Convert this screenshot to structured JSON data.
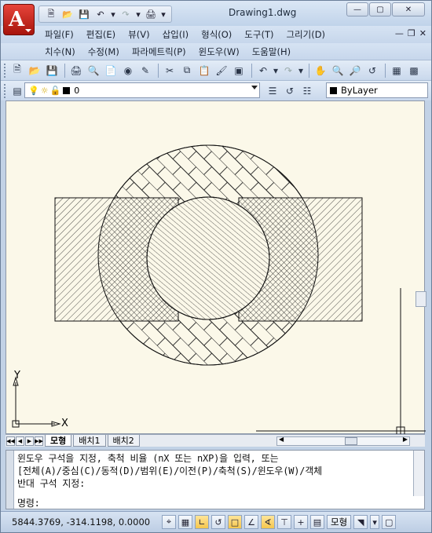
{
  "window": {
    "title": "Drawing1.dwg"
  },
  "qat": {
    "icons": [
      "new-icon",
      "open-icon",
      "save-icon",
      "undo-icon",
      "redo-icon",
      "plot-icon"
    ]
  },
  "menu": {
    "row1": [
      "파일(F)",
      "편집(E)",
      "뷰(V)",
      "삽입(I)",
      "형식(O)",
      "도구(T)",
      "그리기(D)"
    ],
    "row2": [
      "치수(N)",
      "수정(M)",
      "파라메트릭(P)",
      "윈도우(W)",
      "도움말(H)"
    ]
  },
  "layer": {
    "current": "0"
  },
  "properties": {
    "color": "ByLayer"
  },
  "ucs": {
    "x_label": "X",
    "y_label": "Y"
  },
  "layout_tabs": {
    "model": "모형",
    "layout1": "배치1",
    "layout2": "배치2"
  },
  "command": {
    "lines": [
      "윈도우 구석을 지정, 축척 비율 (nX 또는 nXP)을 입력, 또는",
      "[전체(A)/중심(C)/동적(D)/범위(E)/이전(P)/축척(S)/윈도우(W)/객체",
      "반대 구석 지정:"
    ],
    "prompt": "명령:"
  },
  "status": {
    "coordinates": "5844.3769, -314.1198, 0.0000",
    "model_label": "모형"
  }
}
